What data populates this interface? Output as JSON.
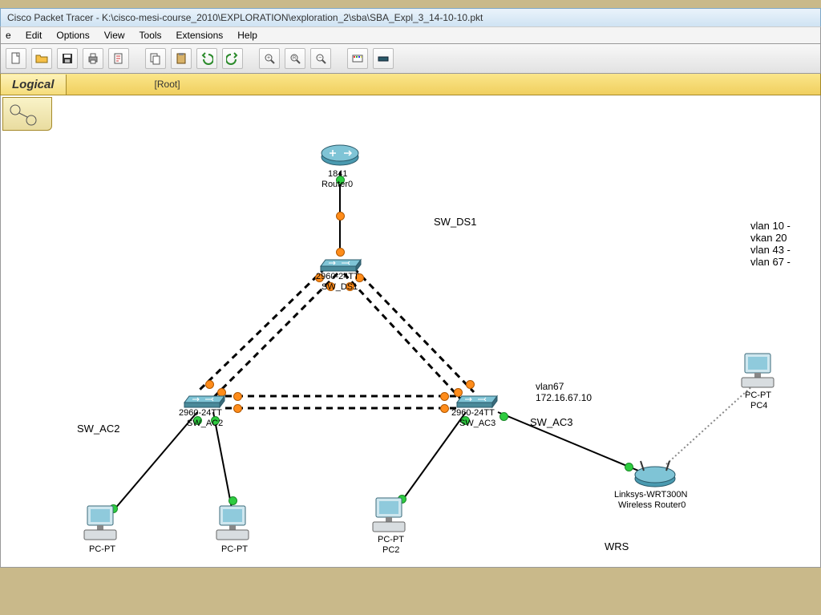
{
  "window": {
    "title": "Cisco Packet Tracer - K:\\cisco-mesi-course_2010\\EXPLORATION\\exploration_2\\sba\\SBA_Expl_3_14-10-10.pkt"
  },
  "menu": {
    "file": "e",
    "edit": "Edit",
    "options": "Options",
    "view": "View",
    "tools": "Tools",
    "extensions": "Extensions",
    "help": "Help"
  },
  "bar": {
    "logical": "Logical",
    "root": "[Root]"
  },
  "labels": {
    "router0_model": "1841",
    "router0_name": "Router0",
    "sw_ds1": "SW_DS1",
    "sw_ds1_model": "2960-24TT",
    "sw_ds1_name": "SW_DS1",
    "sw_ac2_model": "2960-24TT",
    "sw_ac2_name": "SW_AC2",
    "sw_ac2_big": "SW_AC2",
    "sw_ac3_model": "2960-24TT",
    "sw_ac3_name": "SW_AC3",
    "sw_ac3_big": "SW_AC3",
    "vlan67_a": "vlan67",
    "vlan67_b": "172.16.67.10",
    "wrouter_model": "Linksys-WRT300N",
    "wrouter_name": "Wireless Router0",
    "wrs": "WRS",
    "pcpt": "PC-PT",
    "pc2": "PC2",
    "pc4": "PC4",
    "vlan_list1": "vlan 10 -",
    "vlan_list2": "vkan 20",
    "vlan_list3": "vlan 43 -",
    "vlan_list4": "vlan 67 -"
  }
}
